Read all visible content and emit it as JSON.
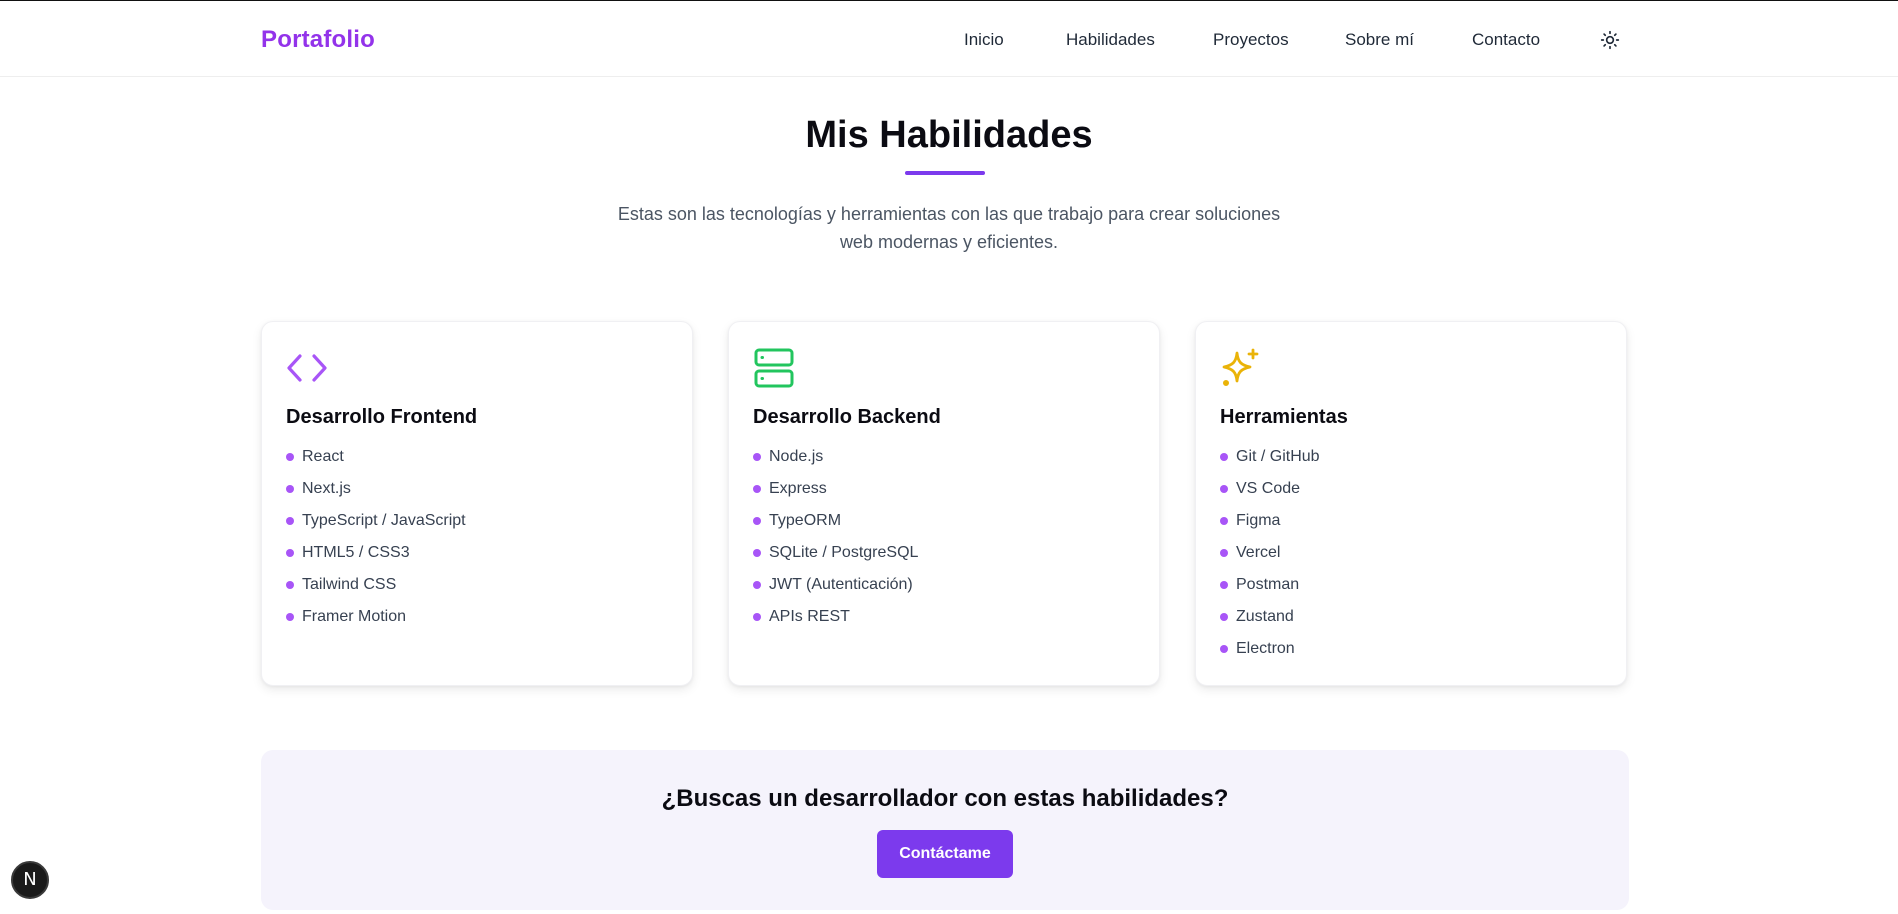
{
  "nav": {
    "brand": "Portafolio",
    "links": [
      "Inicio",
      "Habilidades",
      "Proyectos",
      "Sobre mí",
      "Contacto"
    ],
    "theme_icon": "sun-icon"
  },
  "section": {
    "title": "Mis Habilidades",
    "subtitle": "Estas son las tecnologías y herramientas con las que trabajo para crear soluciones web modernas y eficientes."
  },
  "cards": [
    {
      "icon": "code-icon",
      "icon_color": "#a855f7",
      "title": "Desarrollo Frontend",
      "items": [
        "React",
        "Next.js",
        "TypeScript / JavaScript",
        "HTML5 / CSS3",
        "Tailwind CSS",
        "Framer Motion"
      ]
    },
    {
      "icon": "server-icon",
      "icon_color": "#22c55e",
      "title": "Desarrollo Backend",
      "items": [
        "Node.js",
        "Express",
        "TypeORM",
        "SQLite / PostgreSQL",
        "JWT (Autenticación)",
        "APIs REST"
      ]
    },
    {
      "icon": "sparkles-icon",
      "icon_color": "#eab308",
      "title": "Herramientas",
      "items": [
        "Git / GitHub",
        "VS Code",
        "Figma",
        "Vercel",
        "Postman",
        "Zustand",
        "Electron"
      ]
    }
  ],
  "cta": {
    "heading": "¿Buscas un desarrollador con estas habilidades?",
    "button": "Contáctame"
  },
  "dev_badge": "N",
  "colors": {
    "accent": "#7c3aed",
    "brand": "#9333ea",
    "bullet": "#a855f7",
    "cta_bg": "#f5f3fc"
  }
}
